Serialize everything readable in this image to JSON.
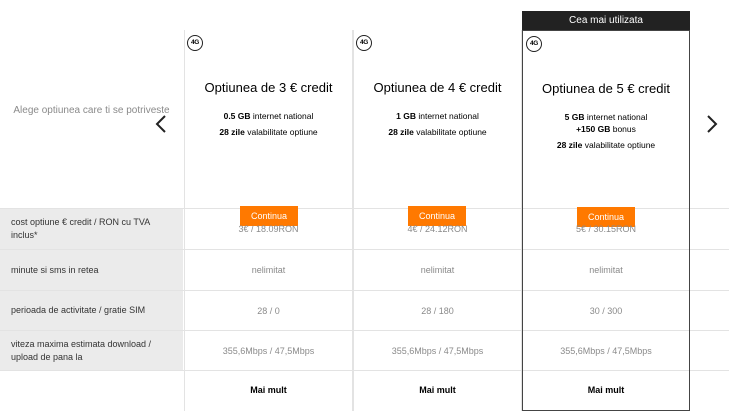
{
  "prompt": "Alege optiunea care ti se potriveste",
  "badge": "Cea mai utilizata",
  "network_badge": "4G",
  "options": [
    {
      "title": "Optiunea de 3 € credit",
      "lines": [
        {
          "bold": "0.5 GB",
          "text": " internet national"
        },
        {
          "bold": "28 zile",
          "text": " valabilitate optiune"
        }
      ],
      "button": "Continua",
      "cost": "3€ / 18.09RON",
      "minutes": "nelimitat",
      "period": "28 / 0",
      "speed": "355,6Mbps / 47,5Mbps",
      "more": "Mai mult"
    },
    {
      "title": "Optiunea de 4 € credit",
      "lines": [
        {
          "bold": "1 GB",
          "text": " internet national"
        },
        {
          "bold": "28 zile",
          "text": " valabilitate optiune"
        }
      ],
      "button": "Continua",
      "cost": "4€ / 24.12RON",
      "minutes": "nelimitat",
      "period": "28 / 180",
      "speed": "355,6Mbps / 47,5Mbps",
      "more": "Mai mult"
    },
    {
      "title": "Optiunea de 5 € credit",
      "lines": [
        {
          "bold": "5 GB",
          "text": " internet national"
        },
        {
          "bold": "+150 GB",
          "text": " bonus"
        },
        {
          "bold": "28 zile",
          "text": " valabilitate optiune"
        }
      ],
      "button": "Continua",
      "cost": "5€ / 30.15RON",
      "minutes": "nelimitat",
      "period": "30 / 300",
      "speed": "355,6Mbps / 47,5Mbps",
      "more": "Mai mult"
    }
  ],
  "rows": [
    "cost optiune € credit / RON cu TVA inclus*",
    "minute si sms in retea",
    "perioada de activitate / gratie SIM",
    "viteza maxima estimata download / upload de pana la"
  ],
  "colors": {
    "accent": "#ff7900",
    "badge_bg": "#222222",
    "label_bg": "#ebebeb"
  },
  "icons": {
    "prev": "chevron-left-icon",
    "next": "chevron-right-icon"
  }
}
